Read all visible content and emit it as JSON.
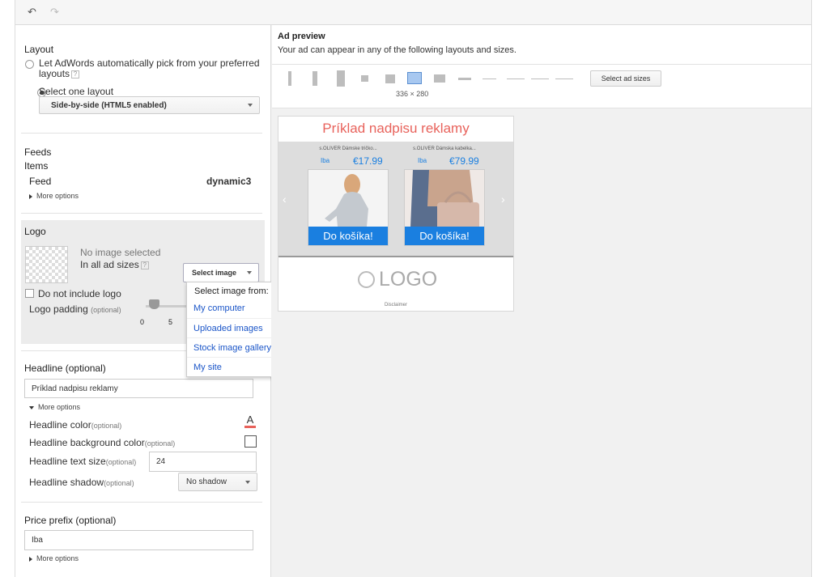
{
  "toolbar": {
    "undo_icon": "undo-icon",
    "redo_icon": "redo-icon"
  },
  "layout": {
    "title": "Layout",
    "option_auto": "Let AdWords automatically pick from your preferred",
    "option_auto_2": "layouts",
    "option_select": "Select one layout",
    "selected_layout": "Side-by-side (HTML5 enabled)"
  },
  "feeds": {
    "title": "Feeds",
    "items_label": "Items",
    "feed_label": "Feed",
    "feed_value": "dynamic3",
    "more_options": "More options"
  },
  "logo": {
    "title": "Logo",
    "no_image": "No image selected",
    "all_sizes": "In all ad sizes",
    "select_image": "Select image",
    "do_not_include": "Do not include logo",
    "padding_label": "Logo padding",
    "optional": "(optional)",
    "slider_min": "0",
    "slider_mid": "5"
  },
  "select_menu": {
    "header": "Select image from:",
    "items": [
      "My computer",
      "Uploaded images",
      "Stock image gallery",
      "My site"
    ]
  },
  "headline": {
    "title": "Headline",
    "optional": "(optional)",
    "value": "Príklad nadpisu reklamy",
    "more_options": "More options",
    "color_label": "Headline color",
    "bg_color_label": "Headline background color",
    "text_size_label": "Headline text size",
    "text_size_value": "24",
    "shadow_label": "Headline shadow",
    "shadow_value": "No shadow"
  },
  "price_prefix": {
    "title": "Price prefix",
    "optional": "(optional)",
    "value": "Iba",
    "more_options": "More options"
  },
  "preview": {
    "title": "Ad preview",
    "subtitle": "Your ad can appear in any of the following layouts and sizes.",
    "selected_size": "336 × 280",
    "select_sizes_button": "Select ad sizes",
    "ad_headline": "Príklad nadpisu reklamy",
    "products": [
      {
        "name": "s.OLIVER Dámske tričko...",
        "prefix": "Iba",
        "price": "€17.99",
        "button": "Do košíka!"
      },
      {
        "name": "s.OLIVER Dámska kabelka...",
        "prefix": "Iba",
        "price": "€79.99",
        "button": "Do košíka!"
      }
    ],
    "logo_text": "LOGO",
    "disclaimer": "Disclaimer"
  },
  "colors": {
    "accent": "#1a7fe0",
    "link": "#1a55c8",
    "headline": "#e8625b",
    "selected_size": "#a8c8f0"
  }
}
